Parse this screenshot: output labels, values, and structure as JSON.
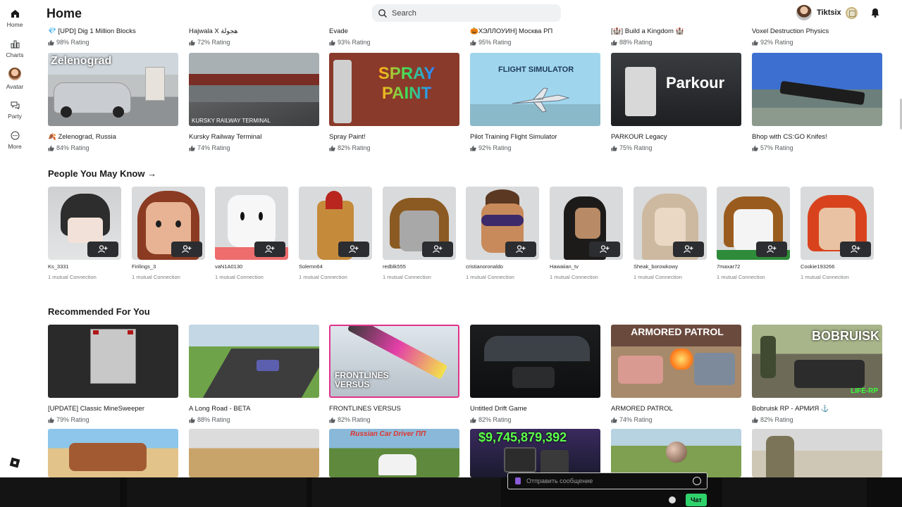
{
  "nav": {
    "items": [
      {
        "label": "Home",
        "icon": "home-icon"
      },
      {
        "label": "Charts",
        "icon": "charts-icon"
      },
      {
        "label": "Avatar",
        "icon": "avatar-icon"
      },
      {
        "label": "Party",
        "icon": "party-icon"
      },
      {
        "label": "More",
        "icon": "more-icon"
      }
    ]
  },
  "header": {
    "title": "Home",
    "search_placeholder": "Search",
    "username": "Tiktsix"
  },
  "top_games": [
    {
      "title": "💎 [UPD] Dig 1 Million Blocks",
      "rating": "98% Rating"
    },
    {
      "title": "Hajwala X هجولة",
      "rating": "72% Rating"
    },
    {
      "title": "Evade",
      "rating": "93% Rating"
    },
    {
      "title": "🎃ХЭЛЛОУИН] Москва РП",
      "rating": "95% Rating"
    },
    {
      "title": "[🏰] Build a Kingdom 🏰",
      "rating": "88% Rating"
    },
    {
      "title": "Voxel Destruction Physics",
      "rating": "92% Rating"
    }
  ],
  "games_row2": [
    {
      "title": "🍂 Zelenograd, Russia",
      "rating": "84% Rating",
      "thumb_text": "Zelenograd"
    },
    {
      "title": "Kursky Railway Terminal",
      "rating": "74% Rating",
      "thumb_text": "KURSKY RAILWAY TERMINAL"
    },
    {
      "title": "Spray Paint!",
      "rating": "82% Rating",
      "thumb_text": "SPRAY PAINT"
    },
    {
      "title": "Pilot Training Flight Simulator",
      "rating": "92% Rating",
      "thumb_text": "FLIGHT SIMULATOR"
    },
    {
      "title": "PARKOUR Legacy",
      "rating": "75% Rating",
      "thumb_text": "Parkour"
    },
    {
      "title": "Bhop with CS:GO Knifes!",
      "rating": "57% Rating",
      "thumb_text": ""
    }
  ],
  "people_section": {
    "title": "People You May Know →",
    "people": [
      {
        "name": "Ks_3331",
        "mutual": "1 mutual Connection"
      },
      {
        "name": "Firilings_3",
        "mutual": "1 mutual Connection"
      },
      {
        "name": "vaN1A0130",
        "mutual": "1 mutual Connection"
      },
      {
        "name": "Solemn64",
        "mutual": "1 mutual Connection"
      },
      {
        "name": "redblk555",
        "mutual": "1 mutual Connection"
      },
      {
        "name": "cristianoronaldo",
        "mutual": "1 mutual Connection"
      },
      {
        "name": "Hawaiian_tv",
        "mutual": "1 mutual Connection"
      },
      {
        "name": "Sheak_borowkowy",
        "mutual": "1 mutual Connection"
      },
      {
        "name": "7maxar72",
        "mutual": "1 mutual Connection"
      },
      {
        "name": "Cookie193266",
        "mutual": "1 mutual Connection"
      }
    ]
  },
  "recommended_section": {
    "title": "Recommended For You",
    "games": [
      {
        "title": "[UPDATE] Classic MineSweeper",
        "rating": "79% Rating",
        "thumb_text": ""
      },
      {
        "title": "A Long Road - BETA",
        "rating": "88% Rating",
        "thumb_text": ""
      },
      {
        "title": "FRONTLINES VERSUS",
        "rating": "82% Rating",
        "thumb_text": "FRONTLINES VERSUS"
      },
      {
        "title": "Untitled Drift Game",
        "rating": "82% Rating",
        "thumb_text": ""
      },
      {
        "title": "ARMORED PATROL",
        "rating": "74% Rating",
        "thumb_text": "ARMORED PATROL"
      },
      {
        "title": "Bobruisk RP - АРМИЯ ⚓",
        "rating": "82% Rating",
        "thumb_text": "BOBRUISK"
      }
    ]
  },
  "bottom_row_thumbs": [
    {
      "thumb_text": ""
    },
    {
      "thumb_text": ""
    },
    {
      "thumb_text": "Russian Car Driver ПП"
    },
    {
      "thumb_text": "$9,745,879,392"
    },
    {
      "thumb_text": ""
    },
    {
      "thumb_text": ""
    }
  ],
  "chat": {
    "placeholder": "Отправить сообщение",
    "button_label": "Чат"
  },
  "colors": {
    "chat_button": "#2fd16b",
    "chat_icon": "#8a5cd6"
  }
}
